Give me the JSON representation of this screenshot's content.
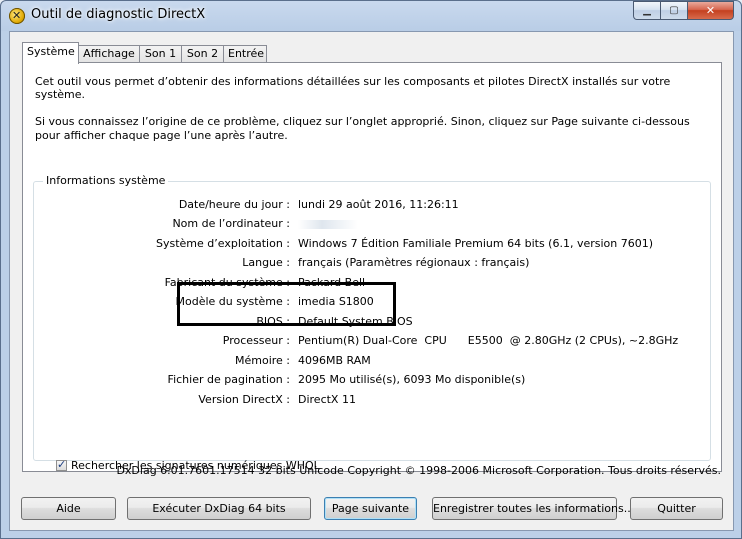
{
  "window": {
    "title": "Outil de diagnostic DirectX",
    "controls": {
      "minimize": "▁",
      "maximize": "▢",
      "close": "✕"
    }
  },
  "tabs": [
    {
      "label": "Système",
      "active": true
    },
    {
      "label": "Affichage",
      "active": false
    },
    {
      "label": "Son 1",
      "active": false
    },
    {
      "label": "Son 2",
      "active": false
    },
    {
      "label": "Entrée",
      "active": false
    }
  ],
  "intro": {
    "line1": "Cet outil vous permet d’obtenir des informations détaillées sur les composants et pilotes DirectX installés sur votre système.",
    "line2": "Si vous connaissez l’origine de ce problème, cliquez sur l’onglet approprié. Sinon, cliquez sur Page suivante ci-dessous pour afficher chaque page l’une après l’autre."
  },
  "system_info": {
    "group_label": "Informations système",
    "rows": [
      {
        "label": "Date/heure du jour :",
        "value": "lundi 29 août 2016, 11:26:11"
      },
      {
        "label": "Nom de l’ordinateur :",
        "value": ""
      },
      {
        "label": "Système d’exploitation :",
        "value": "Windows 7 Édition Familiale Premium 64 bits (6.1, version 7601)"
      },
      {
        "label": "Langue :",
        "value": "français (Paramètres régionaux : français)"
      },
      {
        "label": "Fabricant du système :",
        "value": "Packard Bell"
      },
      {
        "label": "Modèle du système :",
        "value": "imedia S1800"
      },
      {
        "label": "BIOS :",
        "value": "Default System BIOS"
      },
      {
        "label": "Processeur :",
        "value": "Pentium(R) Dual-Core  CPU      E5500  @ 2.80GHz (2 CPUs), ~2.8GHz"
      },
      {
        "label": "Mémoire :",
        "value": "4096MB RAM"
      },
      {
        "label": "Fichier de pagination :",
        "value": "2095 Mo utilisé(s), 6093 Mo disponible(s)"
      },
      {
        "label": "Version DirectX :",
        "value": "DirectX 11"
      }
    ],
    "whql_checkbox": {
      "label": "Rechercher les signatures numériques WHQL",
      "checked": true
    }
  },
  "copyright": "DxDiag 6.01.7601.17514 32 bits Unicode Copyright © 1998-2006 Microsoft Corporation. Tous droits réservés.",
  "buttons": {
    "help": "Aide",
    "run64": "Exécuter DxDiag 64 bits",
    "next": "Page suivante",
    "save": "Enregistrer toutes les informations...",
    "quit": "Quitter"
  }
}
